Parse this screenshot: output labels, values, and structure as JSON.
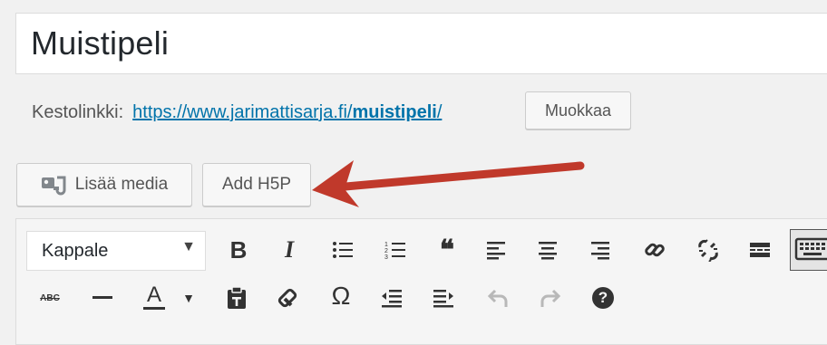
{
  "post": {
    "title": "Muistipeli",
    "permalink_label": "Kestolinkki:",
    "permalink_base": "https://www.jarimattisarja.fi/",
    "permalink_slug": "muistipeli",
    "permalink_end": "/",
    "edit_label": "Muokkaa"
  },
  "media_buttons": {
    "add_media_label": "Lisää media",
    "add_h5p_label": "Add H5P"
  },
  "toolbar": {
    "format_value": "Kappale",
    "icons_row1": [
      "bold-icon",
      "italic-icon",
      "bullet-list-icon",
      "numbered-list-icon",
      "blockquote-icon",
      "align-left-icon",
      "align-center-icon",
      "align-right-icon",
      "link-icon",
      "unlink-icon",
      "read-more-icon",
      "toolbar-toggle-icon"
    ],
    "icons_row2": [
      "strikethrough-icon",
      "horizontal-line-icon",
      "text-color-icon",
      "paste-text-icon",
      "clear-formatting-icon",
      "special-character-icon",
      "outdent-icon",
      "indent-icon",
      "undo-icon",
      "redo-icon",
      "help-icon"
    ],
    "bold_glyph": "B",
    "italic_glyph": "I",
    "quote_glyph": "❝",
    "strike_glyph": "ABC",
    "color_glyph": "A",
    "omega_glyph": "Ω",
    "help_glyph": "?"
  },
  "colors": {
    "accent_link": "#0073aa",
    "arrow": "#c0392b",
    "text_color_underline": "#333333"
  }
}
